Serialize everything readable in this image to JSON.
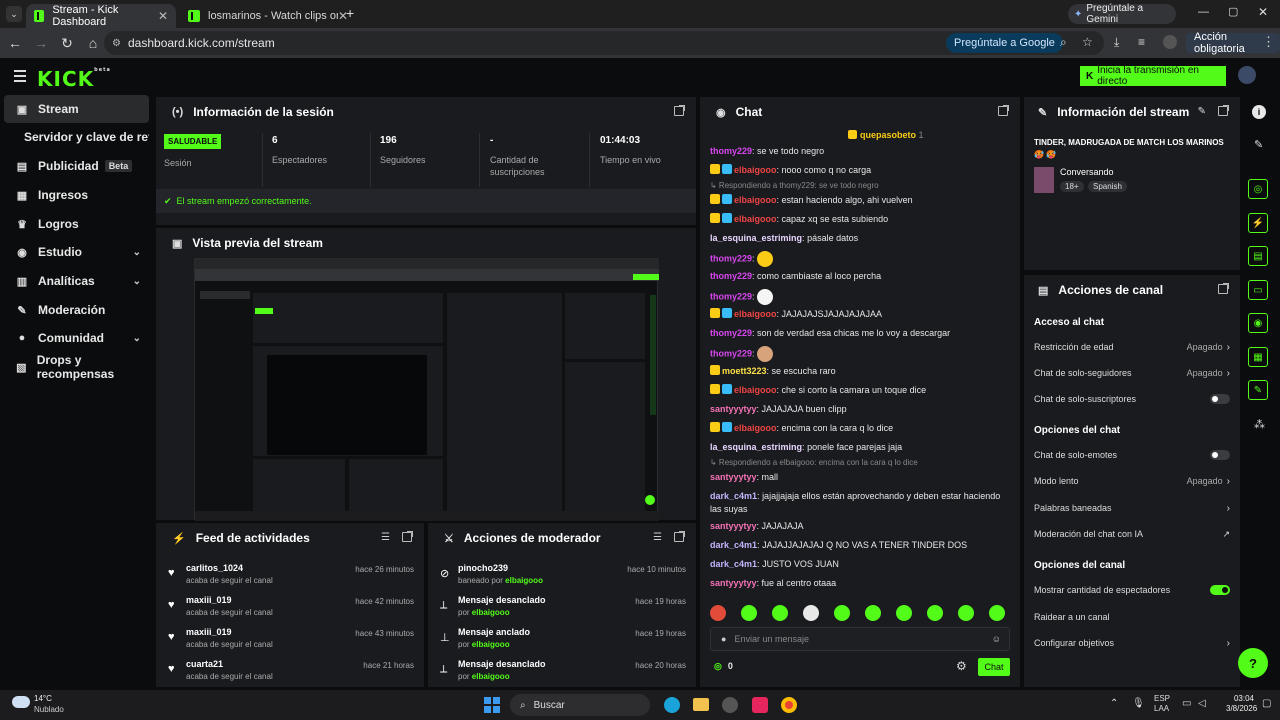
{
  "browser": {
    "tabs": [
      {
        "label": "Stream - Kick Dashboard",
        "active": true
      },
      {
        "label": "losmarinos - Watch clips on Kic",
        "active": false
      }
    ],
    "url": "dashboard.kick.com/stream",
    "gemini_label": "Pregúntale a Gemini",
    "google_pill": "Pregúntale a Google",
    "action_label": "Acción obligatoria"
  },
  "header": {
    "logo": "KICK",
    "logo_sup": "beta",
    "go_live": "Inicia la transmisión en directo"
  },
  "sidebar": {
    "items": [
      {
        "label": "Stream",
        "icon": "stream-icon",
        "active": true
      },
      {
        "label": "Servidor y clave de retransmi",
        "icon": "",
        "active": false
      },
      {
        "label": "Publicidad",
        "badge": "Beta",
        "icon": "ads-icon"
      },
      {
        "label": "Ingresos",
        "icon": "revenue-icon"
      },
      {
        "label": "Logros",
        "icon": "trophy-icon"
      },
      {
        "label": "Estudio",
        "icon": "studio-icon",
        "chevron": true
      },
      {
        "label": "Analíticas",
        "icon": "analytics-icon",
        "chevron": true
      },
      {
        "label": "Moderación",
        "icon": "wrench-icon"
      },
      {
        "label": "Comunidad",
        "icon": "community-icon",
        "chevron": true
      },
      {
        "label": "Drops y recompensas",
        "icon": "drops-icon"
      }
    ]
  },
  "session": {
    "title": "Información de la sesión",
    "health": "SALUDABLE",
    "health_label": "Sesión",
    "stats": [
      {
        "value": "6",
        "label": "Espectadores"
      },
      {
        "value": "196",
        "label": "Seguidores"
      },
      {
        "value": "-",
        "label": "Cantidad de suscripciones"
      },
      {
        "value": "01:44:03",
        "label": "Tiempo en vivo"
      }
    ],
    "status": "El stream empezó correctamente."
  },
  "preview": {
    "title": "Vista previa del stream"
  },
  "feed": {
    "title": "Feed de actividades",
    "rows": [
      {
        "name": "carlitos_1024",
        "sub": "acaba de seguir el canal",
        "time": "hace 26 minutos"
      },
      {
        "name": "maxiii_019",
        "sub": "acaba de seguir el canal",
        "time": "hace 42 minutos"
      },
      {
        "name": "maxiii_019",
        "sub": "acaba de seguir el canal",
        "time": "hace 43 minutos"
      },
      {
        "name": "cuarta21",
        "sub": "acaba de seguir el canal",
        "time": "hace 21 horas"
      }
    ]
  },
  "mod": {
    "title": "Acciones de moderador",
    "rows": [
      {
        "name": "pinocho239",
        "pre": "baneado por",
        "by": "elbaigooo",
        "time": "hace 10 minutos",
        "icon": "ban-icon"
      },
      {
        "name": "Mensaje desanclado",
        "pre": "por",
        "by": "elbaigooo",
        "time": "hace 19 horas",
        "icon": "unpin-icon"
      },
      {
        "name": "Mensaje anclado",
        "pre": "por",
        "by": "elbaigooo",
        "time": "hace 19 horas",
        "icon": "pin-icon"
      },
      {
        "name": "Mensaje desanclado",
        "pre": "por",
        "by": "elbaigooo",
        "time": "hace 20 horas",
        "icon": "unpin-icon"
      }
    ]
  },
  "chat": {
    "title": "Chat",
    "pinned_user": "quepasobeto",
    "pinned_count": "1",
    "messages": [
      {
        "user": "thomy229",
        "color": "#d946ef",
        "text": "se ve todo negro",
        "badges": false
      },
      {
        "user": "elbaigooo",
        "color": "#ef4444",
        "text": "nooo como q no carga",
        "badges": true
      },
      {
        "reply": "Respondiendo a thomy229: se ve todo negro"
      },
      {
        "user": "elbaigooo",
        "color": "#ef4444",
        "text": "estan haciendo algo, ahi vuelven",
        "badges": true
      },
      {
        "user": "elbaigooo",
        "color": "#ef4444",
        "text": "capaz xq se esta subiendo",
        "badges": true
      },
      {
        "user": "la_esquina_estriming",
        "color": "#e9d5ff",
        "text": "pásale datos",
        "badges": false
      },
      {
        "user": "thomy229",
        "color": "#d946ef",
        "text": "",
        "emote": "#facc15",
        "badges": false
      },
      {
        "user": "thomy229",
        "color": "#d946ef",
        "text": "como cambiaste al loco percha",
        "badges": false
      },
      {
        "user": "thomy229",
        "color": "#d946ef",
        "text": "",
        "emote": "#f5f5f5",
        "badges": false
      },
      {
        "user": "elbaigooo",
        "color": "#ef4444",
        "text": "JAJAJAJSJAJAJAJAJAA",
        "badges": true
      },
      {
        "user": "thomy229",
        "color": "#d946ef",
        "text": "son de verdad esa chicas me lo voy a descargar",
        "badges": false
      },
      {
        "user": "thomy229",
        "color": "#d946ef",
        "text": "",
        "emote": "#d6a37a",
        "badges": false
      },
      {
        "user": "moett3223",
        "color": "#fde047",
        "text": "se escucha raro",
        "badges": "one"
      },
      {
        "user": "elbaigooo",
        "color": "#ef4444",
        "text": "che si corto la camara un toque dice",
        "badges": true
      },
      {
        "user": "santyyytyy",
        "color": "#f472b6",
        "text": "JAJAJAJA buen clipp",
        "badges": false
      },
      {
        "user": "elbaigooo",
        "color": "#ef4444",
        "text": "encima con la cara q lo dice",
        "badges": true
      },
      {
        "user": "la_esquina_estriming",
        "color": "#e9d5ff",
        "text": "ponele face parejas jaja",
        "badges": false
      },
      {
        "reply": "Respondiendo a elbaigooo: encima con la cara q lo dice"
      },
      {
        "user": "santyyytyy",
        "color": "#f472b6",
        "text": "mall",
        "badges": false
      },
      {
        "user": "dark_c4m1",
        "color": "#c4b5fd",
        "text": "jajajjajaja ellos están aprovechando y deben estar haciendo las suyas",
        "badges": false
      },
      {
        "user": "santyyytyy",
        "color": "#f472b6",
        "text": "JAJAJAJA",
        "badges": false
      },
      {
        "user": "dark_c4m1",
        "color": "#c4b5fd",
        "text": "JAJAJJAJAJAJ Q NO VAS A TENER TINDER DOS",
        "badges": false
      },
      {
        "user": "dark_c4m1",
        "color": "#c4b5fd",
        "text": "JUSTO VOS JUAN",
        "badges": false
      },
      {
        "user": "santyyytyy",
        "color": "#f472b6",
        "text": "fue al centro otaaa",
        "badges": false
      }
    ],
    "input_placeholder": "Enviar un mensaje",
    "points": "0",
    "send_label": "Chat"
  },
  "stream_info": {
    "title": "Información del stream",
    "stream_title": "TINDER, MADRUGADA DE MATCH LOS MARINOS 🥵 🥵",
    "category": "Conversando",
    "tags": [
      "18+",
      "Spanish"
    ]
  },
  "channel_actions": {
    "title": "Acciones de canal",
    "sections": [
      {
        "heading": "Acceso al chat",
        "rows": [
          {
            "label": "Restricción de edad",
            "value": "Apagado",
            "kind": "arrow"
          },
          {
            "label": "Chat de solo-seguidores",
            "value": "Apagado",
            "kind": "arrow"
          },
          {
            "label": "Chat de solo-suscriptores",
            "value": "",
            "kind": "toggle",
            "on": false
          }
        ]
      },
      {
        "heading": "Opciones del chat",
        "rows": [
          {
            "label": "Chat de solo-emotes",
            "value": "",
            "kind": "toggle",
            "on": false
          },
          {
            "label": "Modo lento",
            "value": "Apagado",
            "kind": "arrow"
          },
          {
            "label": "Palabras baneadas",
            "value": "",
            "kind": "arrow"
          },
          {
            "label": "Moderación del chat con IA",
            "value": "",
            "kind": "external"
          }
        ]
      },
      {
        "heading": "Opciones del canal",
        "rows": [
          {
            "label": "Mostrar cantidad de espectadores",
            "value": "",
            "kind": "toggle",
            "on": true
          },
          {
            "label": "Raidear a un canal",
            "value": "",
            "kind": "none"
          },
          {
            "label": "Configurar objetivos",
            "value": "",
            "kind": "arrow"
          }
        ]
      }
    ]
  },
  "taskbar": {
    "weather_temp": "14°C",
    "weather_desc": "Nublado",
    "search": "Buscar",
    "lang": "ESP",
    "region": "LAA",
    "time": "03:04",
    "date": "3/8/2026"
  },
  "colors": {
    "accent": "#53fc18",
    "panel": "#191b1f",
    "bg": "#0b0c0d"
  }
}
